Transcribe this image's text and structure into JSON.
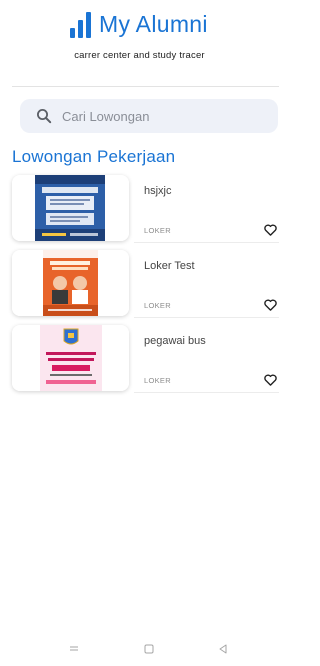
{
  "app": {
    "title": "My Alumni",
    "tagline": "carrer center and study tracer"
  },
  "search": {
    "placeholder": "Cari Lowongan"
  },
  "section": {
    "title": "Lowongan Pekerjaan"
  },
  "jobs": [
    {
      "title": "hsjxjc",
      "tag": "LOKER",
      "poster": {
        "bg": "#2d5fa8",
        "heading": "JOB RECRUITMENT"
      }
    },
    {
      "title": "Loker Test",
      "tag": "LOKER",
      "poster": {
        "bg": "#e8642a"
      }
    },
    {
      "title": "pegawai bus",
      "tag": "LOKER",
      "poster": {
        "bg": "#fbe6ef",
        "heading": "SELEKSI PEGAWAI",
        "subheading": "BUS TRANS JATIM",
        "footer": "DISHUB SURABAYA"
      }
    }
  ],
  "colors": {
    "brand": "#1a74d4",
    "search_bg": "#eef1f8"
  },
  "icons": {
    "search": "search-icon",
    "favorite": "heart-icon",
    "nav": [
      "menu-icon",
      "home-square-icon",
      "back-triangle-icon"
    ]
  }
}
